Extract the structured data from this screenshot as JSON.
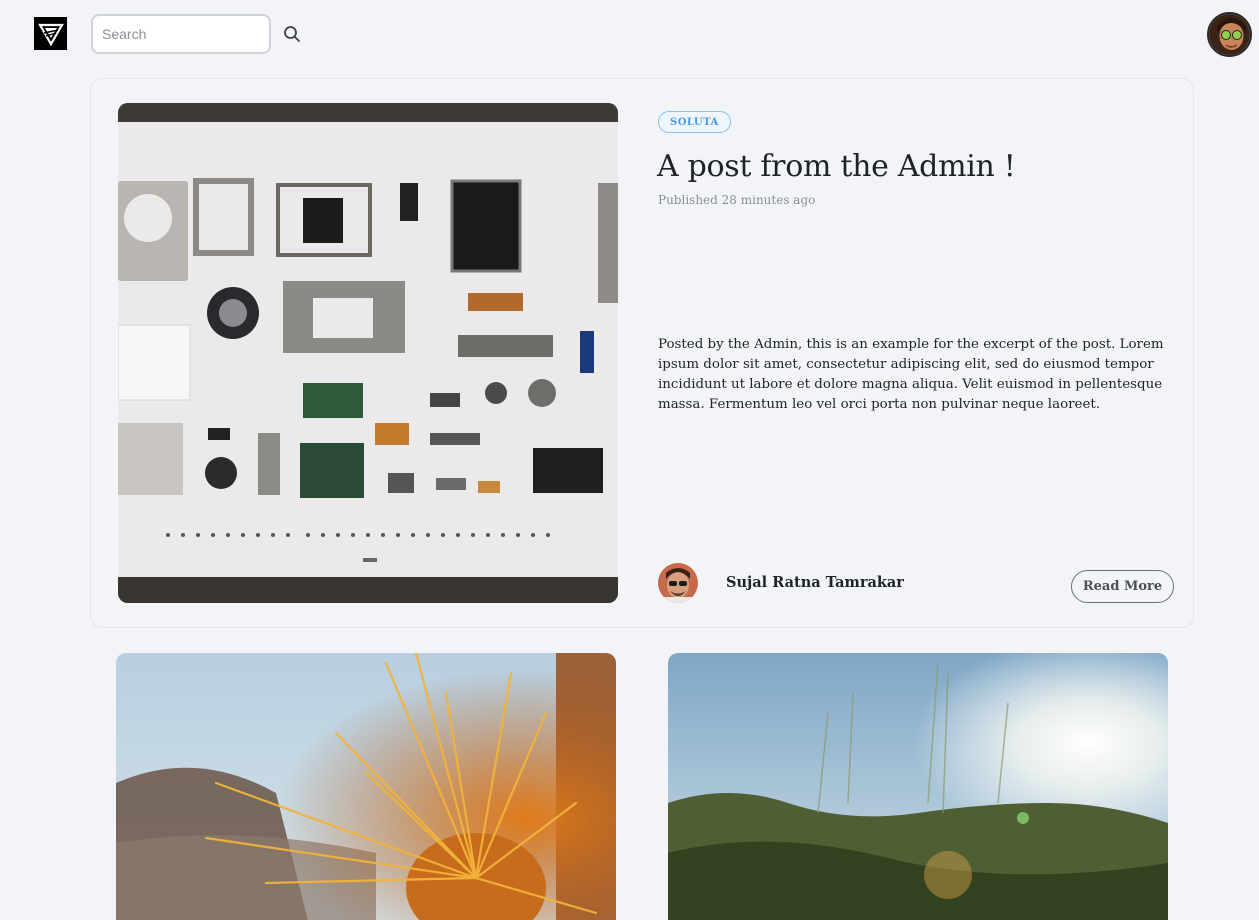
{
  "header": {
    "logo_icon": "brand-logo-icon",
    "search": {
      "placeholder": "Search",
      "value": "",
      "icon": "search-icon"
    },
    "profile_icon": "user-avatar"
  },
  "featured_post": {
    "tag": "SOLUTA",
    "title": "A post from the Admin !",
    "published": "Published 28 minutes ago",
    "excerpt": "Posted by the Admin, this is an example for the excerpt of the post. Lorem ipsum dolor sit amet, consectetur adipiscing elit, sed do eiusmod tempor incididunt ut labore et dolore magna aliqua. Velit euismod in pellentesque massa. Fermentum leo vel orci porta non pulvinar neque laoreet.",
    "author": "Sujal Ratna Tamrakar",
    "read_more": "Read More"
  },
  "colors": {
    "background": "#f2f4f7",
    "tag_border": "#8cc0ee",
    "tag_text": "#4a9be0",
    "text": "#1f2328",
    "muted": "#8a8f96"
  }
}
